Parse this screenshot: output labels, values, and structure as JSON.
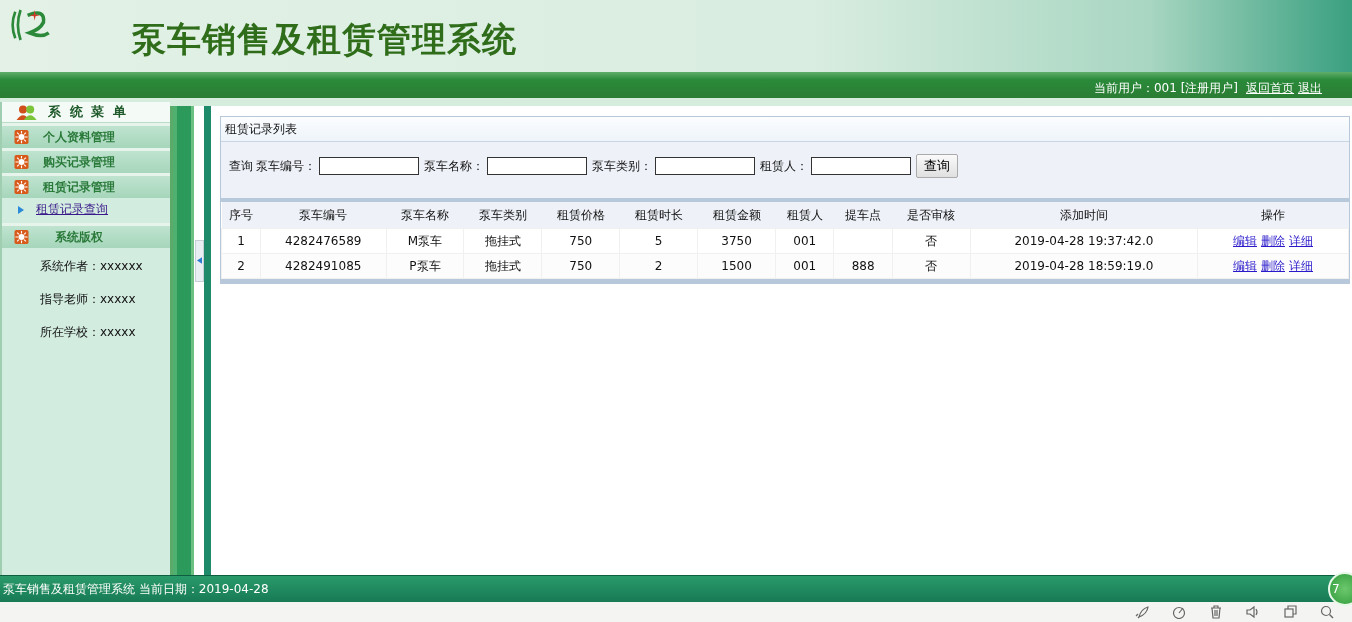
{
  "header": {
    "title": "泵车销售及租赁管理系统"
  },
  "user_bar": {
    "info": "当前用户：001 [注册用户]",
    "links": [
      "返回首页",
      "退出"
    ]
  },
  "sidebar": {
    "title": "系 统 菜 单",
    "groups": [
      {
        "label": "个人资料管理"
      },
      {
        "label": "购买记录管理"
      },
      {
        "label": "租赁记录管理",
        "children": [
          {
            "label": "租赁记录查询"
          }
        ]
      }
    ],
    "copyright": {
      "label": "系统版权",
      "lines": [
        "系统作者：xxxxxx",
        "指导老师：xxxxx",
        "所在学校：xxxxx"
      ]
    }
  },
  "panel": {
    "title": "租赁记录列表",
    "search": {
      "label": "查询",
      "fields": [
        {
          "label": "泵车编号："
        },
        {
          "label": "泵车名称："
        },
        {
          "label": "泵车类别："
        },
        {
          "label": "租赁人："
        }
      ],
      "button": "查询"
    },
    "table": {
      "columns": [
        "序号",
        "泵车编号",
        "泵车名称",
        "泵车类别",
        "租赁价格",
        "租赁时长",
        "租赁金额",
        "租赁人",
        "提车点",
        "是否审核",
        "添加时间",
        "操作"
      ],
      "rows": [
        {
          "cells": [
            "1",
            "4282476589",
            "M泵车",
            "拖挂式",
            "750",
            "5",
            "3750",
            "001",
            "",
            "否",
            "2019-04-28 19:37:42.0"
          ],
          "actions": [
            "编辑",
            "删除",
            "详细"
          ]
        },
        {
          "cells": [
            "2",
            "4282491085",
            "P泵车",
            "拖挂式",
            "750",
            "2",
            "1500",
            "001",
            "888",
            "否",
            "2019-04-28 18:59:19.0"
          ],
          "actions": [
            "编辑",
            "删除",
            "详细"
          ]
        }
      ]
    }
  },
  "status_bar": {
    "text": "泵车销售及租赁管理系统 当前日期：2019-04-28",
    "badge": "7"
  }
}
